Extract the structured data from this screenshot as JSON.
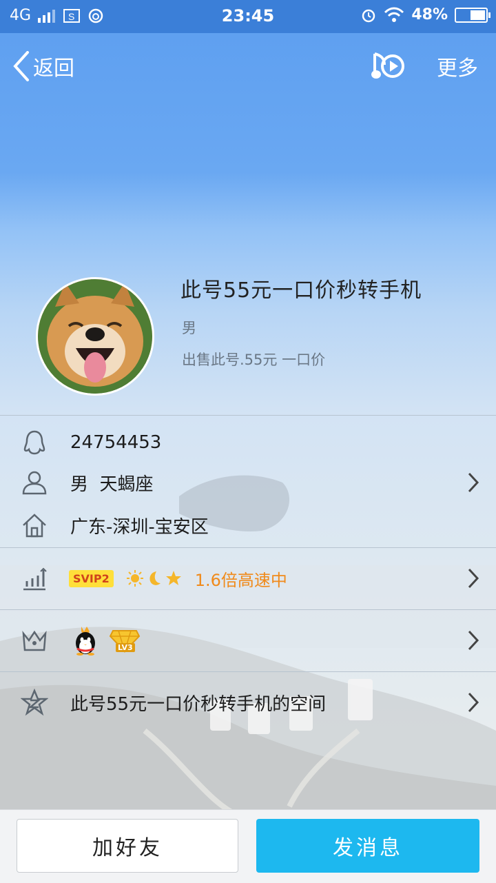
{
  "status_bar": {
    "network": "4G",
    "time": "23:45",
    "battery": "48%",
    "battery_level": 0.48
  },
  "nav": {
    "back_label": "返回",
    "more_label": "更多"
  },
  "profile": {
    "name": "此号55元一口价秒转手机",
    "gender": "男",
    "signature": "出售此号.55元 一口价"
  },
  "info": {
    "qq_number": "24754453",
    "gender_zodiac": "男  天蝎座",
    "location": "广东-深圳-宝安区",
    "svip_badge": "SVIP2",
    "speed_text": "1.6倍高速中",
    "level_badge": "LV3",
    "space_label": "此号55元一口价秒转手机的空间"
  },
  "actions": {
    "add_friend": "加好友",
    "send_message": "发消息"
  },
  "colors": {
    "status_bar": "#3b7fd8",
    "primary_button": "#1db8ef",
    "speed_text": "#f08a1a",
    "svip_badge_bg": "#ffdf3a"
  }
}
